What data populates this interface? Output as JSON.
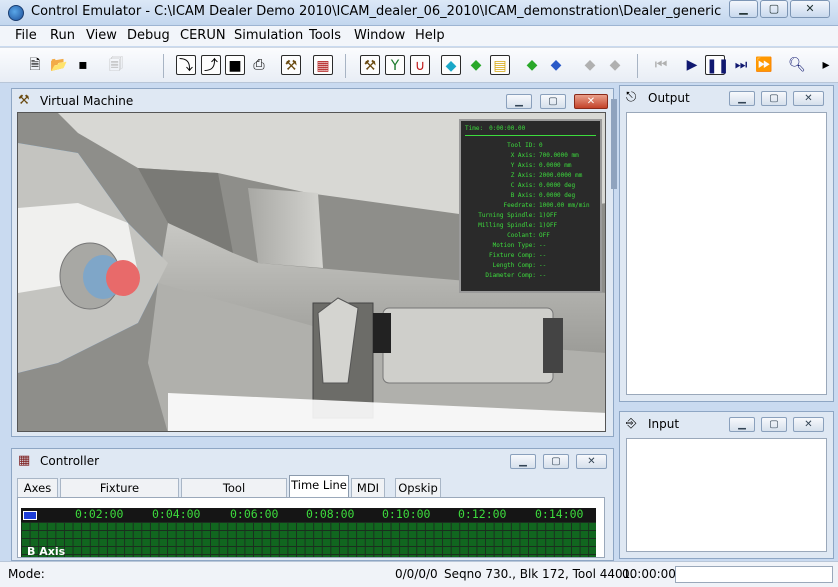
{
  "window": {
    "title": "Control Emulator - C:\\ICAM Dealer Demo 2010\\ICAM_dealer_06_2010\\ICAM_demonstration\\Dealer_generic\\Cd_CE_VM\\W...",
    "minimize": "▁",
    "maximize": "▢",
    "close": "✕"
  },
  "menu": [
    "File",
    "Run",
    "View",
    "Debug",
    "CERUN",
    "Simulation",
    "Tools",
    "Window",
    "Help"
  ],
  "toolbar": {
    "icons": [
      "new-file",
      "open-folder",
      "save-disk",
      "print-preview",
      "step-into",
      "step-out",
      "stop-square",
      "load-program",
      "machine-view",
      "layout-grid",
      "vm-machine",
      "tool-magnet",
      "tool-u",
      "cube-cyan",
      "cube-green",
      "sheets-yellow",
      "cube-green-2",
      "cube-blue",
      "cube-disabled",
      "cube-disabled-2",
      "rewind",
      "play",
      "pause",
      "step-forward",
      "fast-forward",
      "magnifier",
      "extra"
    ]
  },
  "vm_panel": {
    "title": "Virtual Machine",
    "info": [
      {
        "label": "Time:",
        "value": "0:00:00.00"
      },
      {
        "label": "Tool ID:",
        "value": "0"
      },
      {
        "label": "X Axis:",
        "value": "700.0000 mm"
      },
      {
        "label": "Y Axis:",
        "value": "0.0000 mm"
      },
      {
        "label": "Z Axis:",
        "value": "2000.0000 mm"
      },
      {
        "label": "C Axis:",
        "value": "0.0000 deg"
      },
      {
        "label": "B Axis:",
        "value": "0.0000 deg"
      },
      {
        "label": "Feedrate:",
        "value": "1000.00 mm/min"
      },
      {
        "label": "Turning Spindle:",
        "value": "1)OFF"
      },
      {
        "label": "Milling Spindle:",
        "value": "1)OFF"
      },
      {
        "label": "Coolant:",
        "value": "OFF"
      },
      {
        "label": "Motion Type:",
        "value": "--"
      },
      {
        "label": "Fixture Comp:",
        "value": "--"
      },
      {
        "label": "Length Comp:",
        "value": "--"
      },
      {
        "label": "Diameter Comp:",
        "value": "--"
      }
    ]
  },
  "output_panel": {
    "title": "Output"
  },
  "input_panel": {
    "title": "Input"
  },
  "controller": {
    "title": "Controller",
    "tabs": [
      "Axes",
      "Fixture Compensation",
      "Tool Compensation",
      "Time Line",
      "MDI",
      "Opskip"
    ],
    "active_tab": "Time Line",
    "timeline_marks": [
      "0:02:00",
      "0:04:00",
      "0:06:00",
      "0:08:00",
      "0:10:00",
      "0:12:00",
      "0:14:00"
    ],
    "axis_label": "B Axis"
  },
  "status": {
    "mode_label": "Mode:",
    "counter": "0/0/0/0",
    "seq": "Seqno 730., Blk 172, Tool 4401.",
    "time": "00:00:00"
  }
}
